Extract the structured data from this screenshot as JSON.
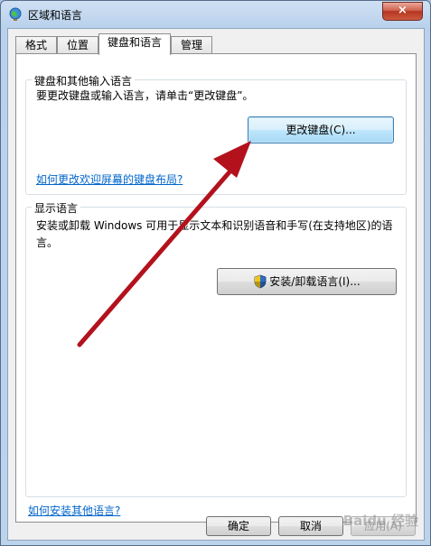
{
  "window": {
    "title": "区域和语言",
    "close_label": "×"
  },
  "tabs": [
    {
      "label": "格式"
    },
    {
      "label": "位置"
    },
    {
      "label": "键盘和语言"
    },
    {
      "label": "管理"
    }
  ],
  "keyboards": {
    "group_title": "键盘和其他输入语言",
    "description": "要更改键盘或输入语言，请单击“更改键盘”。",
    "change_button": "更改键盘(C)...",
    "help_link": "如何更改欢迎屏幕的键盘布局?"
  },
  "display_language": {
    "group_title": "显示语言",
    "description": "安装或卸载 Windows 可用于显示文本和识别语音和手写(在支持地区)的语言。",
    "install_button": "安装/卸载语言(I)..."
  },
  "footer_link": "如何安装其他语言?",
  "buttons": {
    "ok": "确定",
    "cancel": "取消",
    "apply": "应用(A)"
  },
  "annotation": {
    "arrow_color": "#b3121d"
  },
  "watermark": "Baidu 经验"
}
